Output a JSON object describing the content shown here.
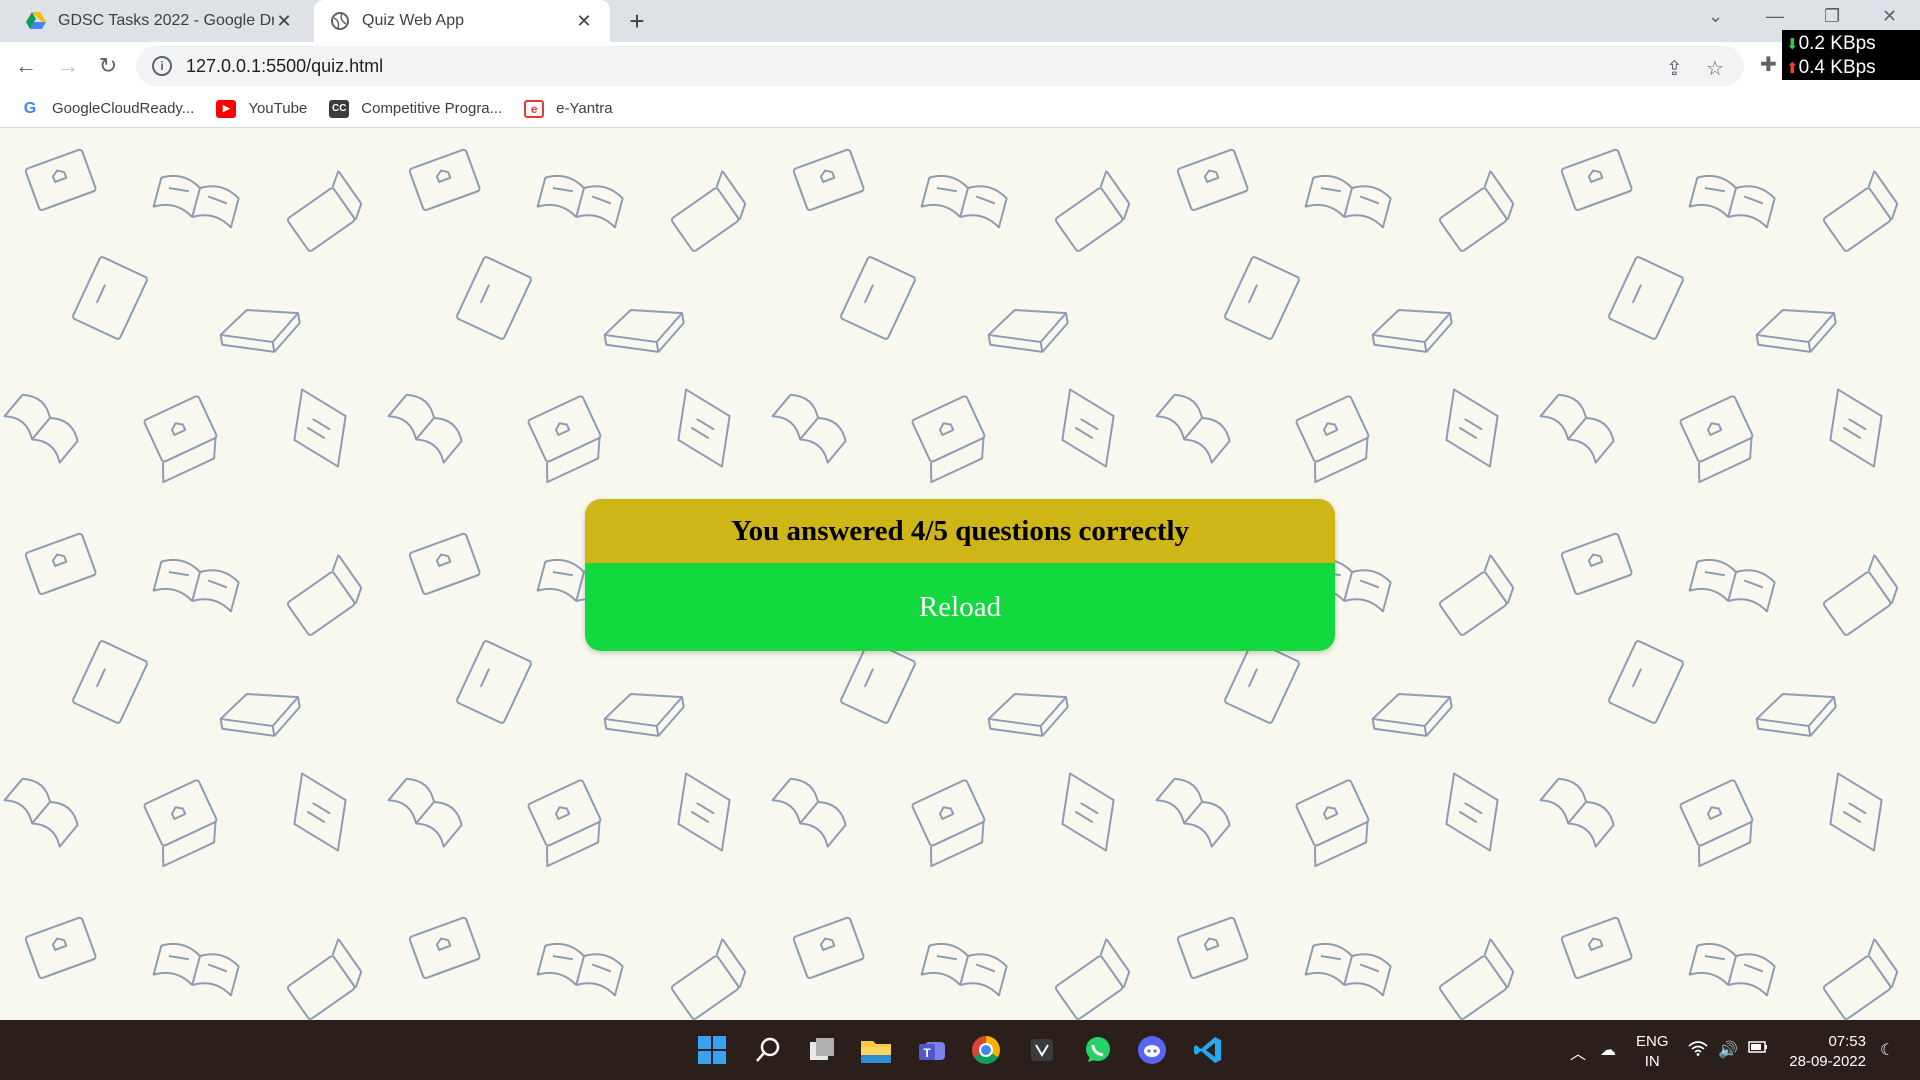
{
  "browser": {
    "tabs": [
      {
        "title": "GDSC Tasks 2022 - Google Drive",
        "icon": "google-drive-icon",
        "active": false
      },
      {
        "title": "Quiz Web App",
        "icon": "globe-icon",
        "active": true
      }
    ],
    "url": "127.0.0.1:5500/quiz.html",
    "bookmarks": [
      {
        "label": "GoogleCloudReady...",
        "icon": "google-icon"
      },
      {
        "label": "YouTube",
        "icon": "youtube-icon"
      },
      {
        "label": "Competitive Progra...",
        "icon": "cc-icon"
      },
      {
        "label": "e-Yantra",
        "icon": "e-yantra-icon"
      }
    ]
  },
  "network_monitor": {
    "download": "0.2 KBps",
    "upload": "0.4 KBps"
  },
  "quiz": {
    "result_text": "You answered 4/5 questions correctly",
    "reload_label": "Reload",
    "header_color": "#cfb617",
    "button_color": "#12d93e"
  },
  "taskbar": {
    "apps": [
      "windows-start-icon",
      "search-icon",
      "task-view-icon",
      "file-explorer-icon",
      "teams-icon",
      "chrome-icon",
      "app-icon",
      "whatsapp-icon",
      "discord-icon",
      "vscode-icon"
    ],
    "language": {
      "line1": "ENG",
      "line2": "IN"
    },
    "time": "07:53",
    "date": "28-09-2022"
  }
}
